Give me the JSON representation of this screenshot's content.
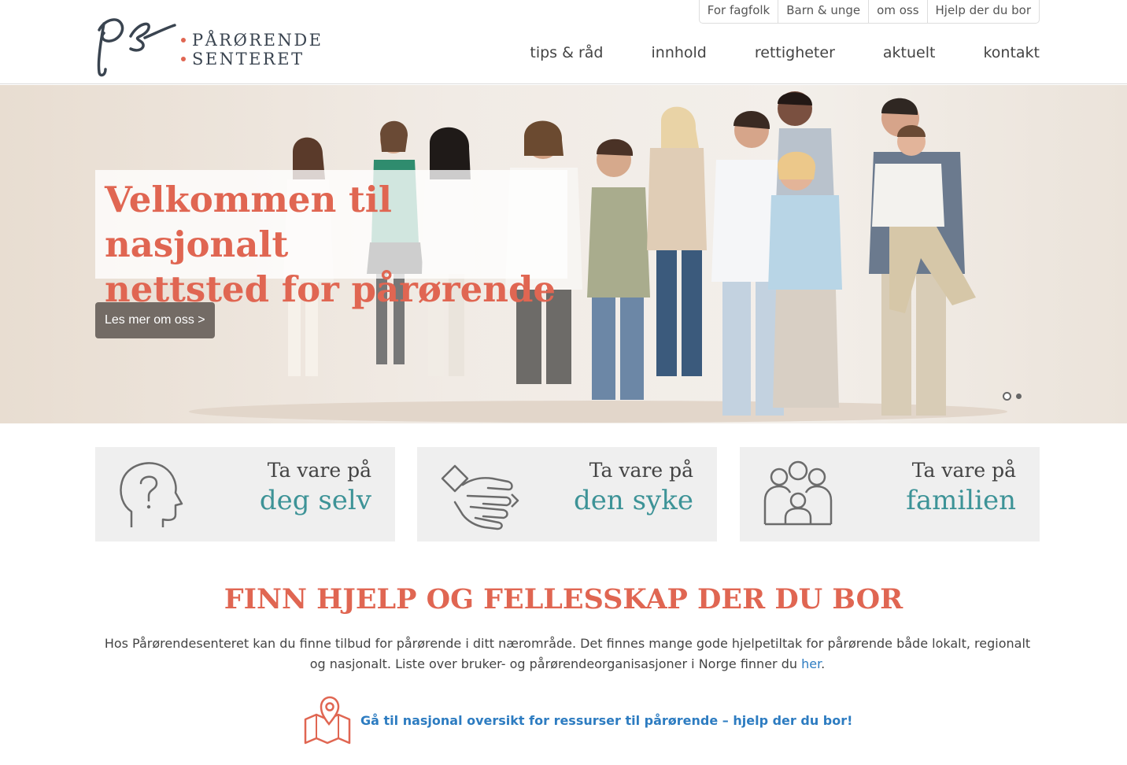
{
  "header": {
    "logo_text_line1": "PÅRØRENDE",
    "logo_text_line2": "SENTERET",
    "top_links": [
      "For fagfolk",
      "Barn & unge",
      "om oss",
      "Hjelp der du bor"
    ],
    "main_links": [
      "tips & råd",
      "innhold",
      "rettigheter",
      "aktuelt",
      "kontakt"
    ]
  },
  "hero": {
    "title_line1": "Velkommen til nasjonalt",
    "title_line2": "nettsted for pårørende",
    "button_label": "Les mer om oss >",
    "slides_count": 2,
    "active_slide": 1
  },
  "cards": [
    {
      "line1": "Ta vare på",
      "line2": "deg selv",
      "icon": "head-question-icon"
    },
    {
      "line1": "Ta vare på",
      "line2": "den syke",
      "icon": "handshake-icon"
    },
    {
      "line1": "Ta vare på",
      "line2": "familien",
      "icon": "family-icon"
    }
  ],
  "section": {
    "title": "FINN HJELP OG FELLESSKAP DER DU BOR",
    "text_before": "Hos Pårørendesenteret kan du finne tilbud for pårørende i ditt nærområde. Det finnes mange gode hjelpetiltak for pårørende både lokalt, regionalt og nasjonalt. Liste over bruker- og pårørendeorganisasjoner i Norge finner du ",
    "link_text": "her",
    "text_after": ".",
    "resource_link": "Gå til nasjonal oversikt for ressurser til pårørende – hjelp der du bor!",
    "resource_icon": "map-pin-icon"
  },
  "colors": {
    "accent": "#e06652",
    "teal": "#3d9397",
    "link": "#2d7cc1",
    "button": "#736b65"
  }
}
